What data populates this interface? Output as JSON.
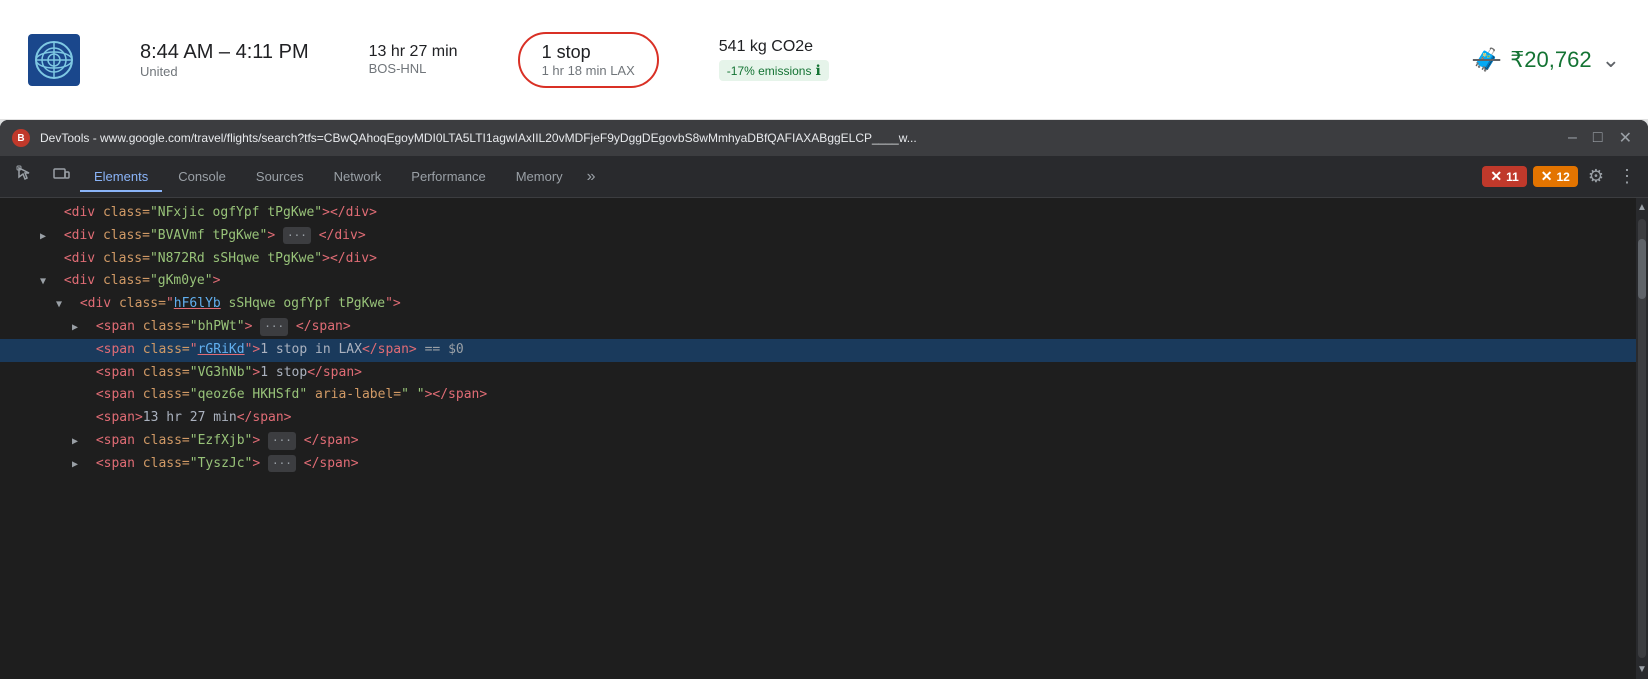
{
  "flight": {
    "time_range": "8:44 AM – 4:11 PM",
    "airline": "United",
    "duration": "13 hr 27 min",
    "route": "BOS-HNL",
    "stops": "1 stop",
    "stops_detail": "1 hr 18 min LAX",
    "co2": "541 kg CO2e",
    "emissions_badge": "-17% emissions",
    "price": "₹20,762",
    "baggage_icon": "🧳"
  },
  "devtools": {
    "title": "DevTools - www.google.com/travel/flights/search?tfs=CBwQAhoqEgoyMDI0LTA5LTI1agwIAxIIL20vMDFjeF9yDggDEgovbS8wMmhyaDBfQAFIAXABggELCP____w...",
    "tabs": [
      {
        "label": "Elements",
        "active": true
      },
      {
        "label": "Console",
        "active": false
      },
      {
        "label": "Sources",
        "active": false
      },
      {
        "label": "Network",
        "active": false
      },
      {
        "label": "Performance",
        "active": false
      },
      {
        "label": "Memory",
        "active": false
      }
    ],
    "error_count": "11",
    "warning_count": "12",
    "html_lines": [
      {
        "indent": 0,
        "content": "&lt;div class=\"NFxjic ogfYpf tPgKwe\"&gt;&lt;/div&gt;",
        "collapsed": false,
        "selected": false
      },
      {
        "indent": 0,
        "content": "&lt;div class=\"BVAVmf tPgKwe\"&gt; ··· &lt;/div&gt;",
        "collapsed": true,
        "selected": false
      },
      {
        "indent": 0,
        "content": "&lt;div class=\"N872Rd sSHqwe tPgKwe\"&gt;&lt;/div&gt;",
        "collapsed": false,
        "selected": false
      },
      {
        "indent": 0,
        "content": "&lt;div class=\"gKm0ye\"&gt;",
        "collapsed": false,
        "selected": false,
        "expanded": true
      },
      {
        "indent": 1,
        "content": "&lt;div class=\"hF6lYb sSHqwe ogfYpf tPgKwe\"&gt;",
        "collapsed": false,
        "selected": false,
        "expanded": true,
        "underline": "hF6lYb"
      },
      {
        "indent": 2,
        "content": "&lt;span class=\"bhPWt\"&gt; ··· &lt;/span&gt;",
        "collapsed": true,
        "selected": false
      },
      {
        "indent": 2,
        "content": "&lt;span class=\"rGRiKd\"&gt;1 stop in LAX&lt;/span&gt; == $0",
        "collapsed": false,
        "selected": true,
        "underline": "rGRiKd"
      },
      {
        "indent": 2,
        "content": "&lt;span class=\"VG3hNb\"&gt;1 stop&lt;/span&gt;",
        "collapsed": false,
        "selected": false
      },
      {
        "indent": 2,
        "content": "&lt;span class=\"qeoz6e HKHSfd\" aria-label=\" \"&gt;&lt;/span&gt;",
        "collapsed": false,
        "selected": false
      },
      {
        "indent": 2,
        "content": "&lt;span&gt;13 hr 27 min&lt;/span&gt;",
        "collapsed": false,
        "selected": false
      },
      {
        "indent": 2,
        "content": "&lt;span class=\"EzfXjb\"&gt; ··· &lt;/span&gt;",
        "collapsed": true,
        "selected": false
      },
      {
        "indent": 2,
        "content": "&lt;span class=\"TyszJc\"&gt; ··· &lt;/span&gt;",
        "collapsed": true,
        "selected": false
      }
    ]
  }
}
